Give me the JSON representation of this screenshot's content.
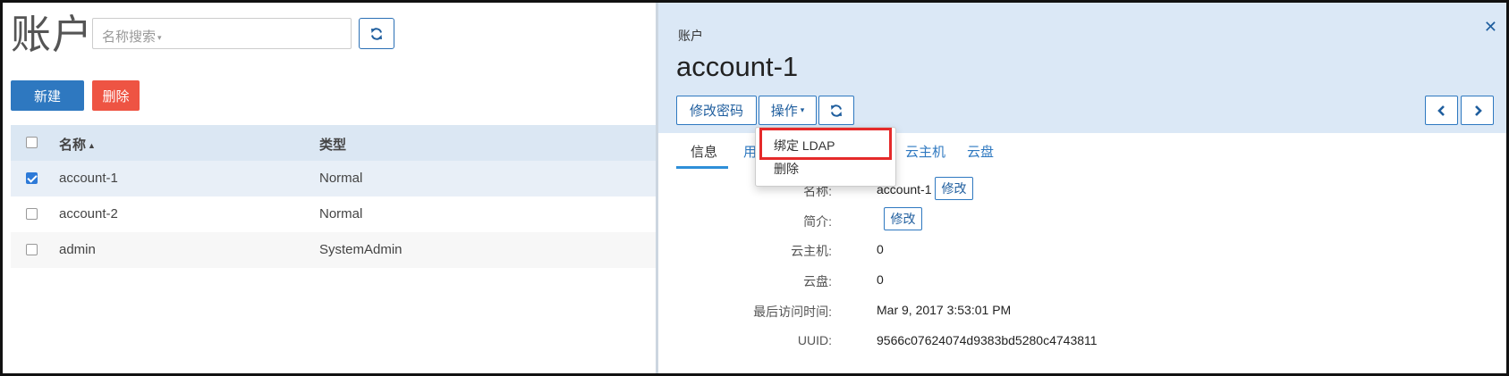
{
  "left": {
    "title": "账户",
    "search": {
      "placeholder": "名称搜索"
    },
    "new_button": "新建",
    "delete_button": "删除",
    "table": {
      "columns": [
        "名称",
        "类型"
      ],
      "rows": [
        {
          "name": "account-1",
          "type": "Normal",
          "checked": true
        },
        {
          "name": "account-2",
          "type": "Normal",
          "checked": false
        },
        {
          "name": "admin",
          "type": "SystemAdmin",
          "checked": false
        }
      ]
    }
  },
  "detail": {
    "breadcrumb": "账户",
    "title": "account-1",
    "actions": {
      "change_password": "修改密码",
      "operations": "操作"
    },
    "tabs": [
      "信息",
      "用",
      "云主机",
      "云盘"
    ],
    "info": [
      {
        "label": "名称:",
        "value": "account-1",
        "edit": "修改"
      },
      {
        "label": "简介:",
        "value": "",
        "edit": "修改"
      },
      {
        "label": "云主机:",
        "value": "0"
      },
      {
        "label": "云盘:",
        "value": "0"
      },
      {
        "label": "最后访问时间:",
        "value": "Mar 9, 2017 3:53:01 PM"
      },
      {
        "label": "UUID:",
        "value": "9566c07624074d9383bd5280c4743811"
      }
    ]
  },
  "dropdown": {
    "items": [
      "绑定 LDAP",
      "删除"
    ]
  },
  "colors": {
    "primary": "#2e78c0",
    "danger": "#ee5443",
    "header_bg": "#dbe8f6",
    "highlight": "#e52a2a"
  },
  "icons": [
    "refresh-icon",
    "close-icon",
    "chevron-left-icon",
    "chevron-right-icon",
    "sort-up-icon",
    "caret-down-icon"
  ]
}
